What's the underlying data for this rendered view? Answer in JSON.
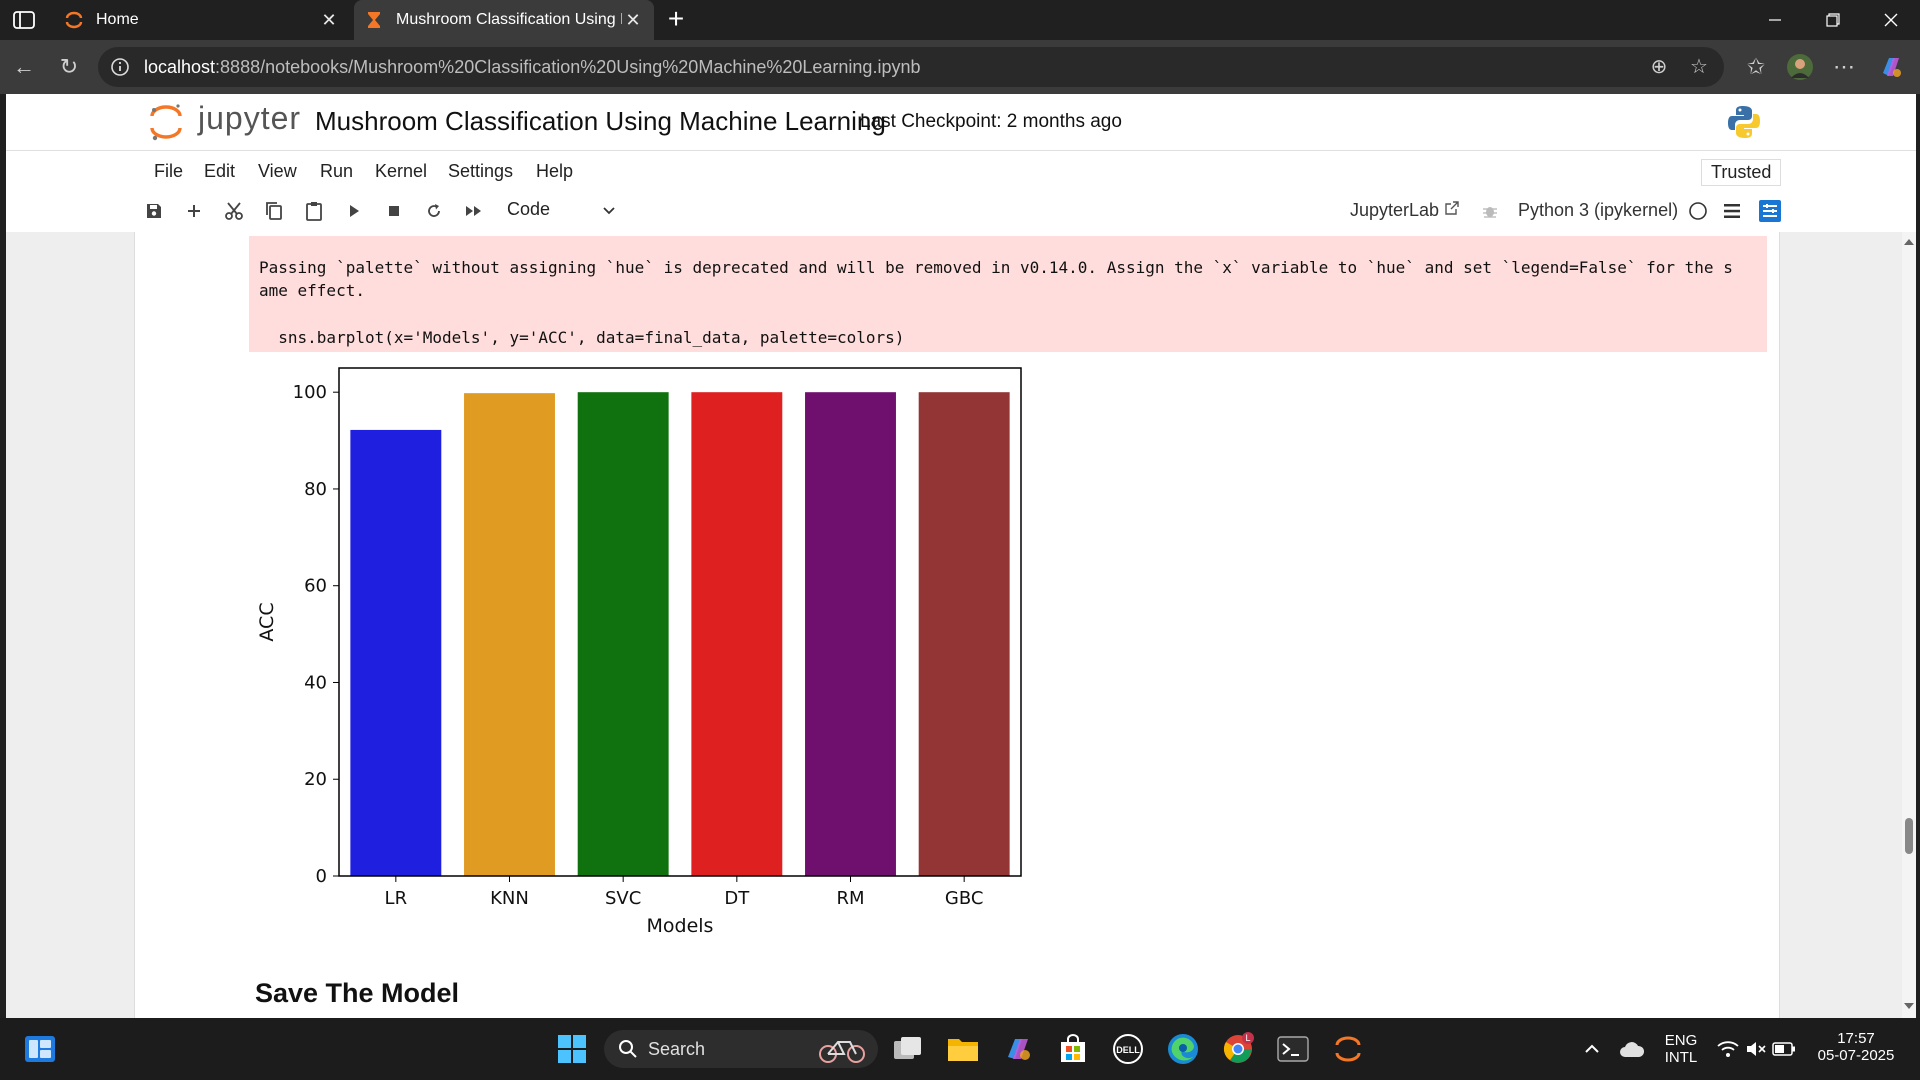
{
  "browser": {
    "tabs": [
      {
        "title": "Home",
        "active": false
      },
      {
        "title": "Mushroom Classification Using M",
        "active": true
      }
    ],
    "url_host": "localhost",
    "url_path": ":8888/notebooks/Mushroom%20Classification%20Using%20Machine%20Learning.ipynb"
  },
  "jupyter": {
    "logo_text": "jupyter",
    "notebook_title": "Mushroom Classification Using Machine Learning",
    "checkpoint": "Last Checkpoint: 2 months ago",
    "menu": [
      "File",
      "Edit",
      "View",
      "Run",
      "Kernel",
      "Settings",
      "Help"
    ],
    "trusted": "Trusted",
    "cell_type": "Code",
    "jupyterlab_label": "JupyterLab",
    "kernel_label": "Python 3 (ipykernel)"
  },
  "output": {
    "stderr_lines": [
      "Passing `palette` without assigning `hue` is deprecated and will be removed in v0.14.0. Assign the `x` variable to `hue` and set `legend=False` for the s",
      "ame effect.",
      "  sns.barplot(x='Models', y='ACC', data=final_data, palette=colors)"
    ]
  },
  "chart_data": {
    "type": "bar",
    "categories": [
      "LR",
      "KNN",
      "SVC",
      "DT",
      "RM",
      "GBC"
    ],
    "values": [
      92.2,
      99.8,
      100,
      100,
      100,
      100
    ],
    "colors": [
      "#1f1fdf",
      "#e09b23",
      "#0f720f",
      "#df2020",
      "#6f106f",
      "#933535"
    ],
    "xlabel": "Models",
    "ylabel": "ACC",
    "ylim": [
      0,
      105
    ],
    "yticks": [
      0,
      20,
      40,
      60,
      80,
      100
    ],
    "grid": false
  },
  "markdown": {
    "heading": "Save The Model"
  },
  "taskbar": {
    "search_label": "Search",
    "lang_line1": "ENG",
    "lang_line2": "INTL",
    "time": "17:57",
    "date": "05-07-2025",
    "chrome_badge": "L"
  }
}
